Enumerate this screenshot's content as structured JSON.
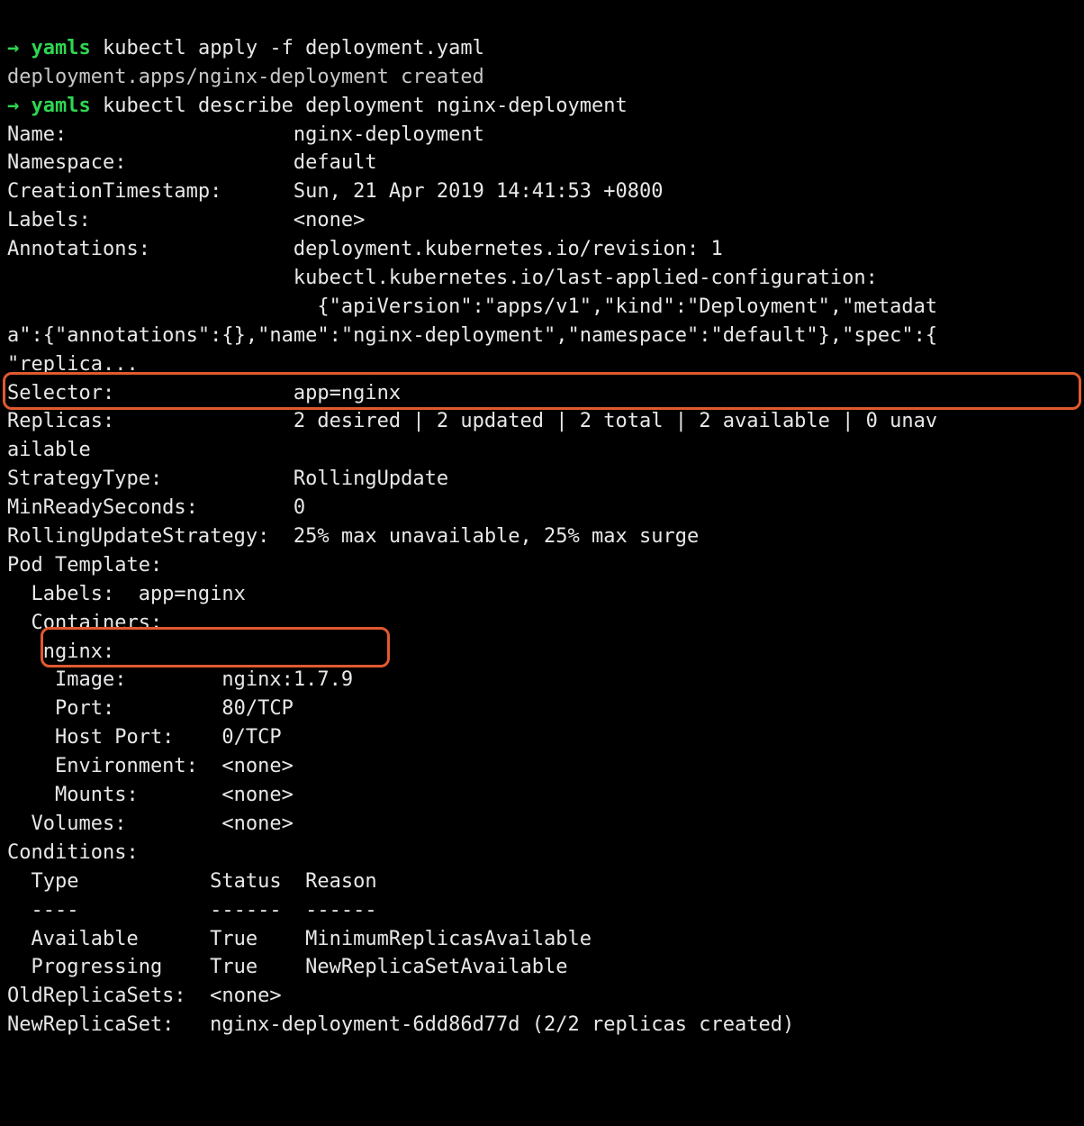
{
  "prompt_arrow": "→",
  "folder": "yamls",
  "cmd1": "kubectl apply -f deployment.yaml",
  "out1": "deployment.apps/nginx-deployment created",
  "cmd2": "kubectl describe deployment nginx-deployment",
  "fields": {
    "name_k": "Name:                   ",
    "name_v": "nginx-deployment",
    "ns_k": "Namespace:              ",
    "ns_v": "default",
    "ct_k": "CreationTimestamp:      ",
    "ct_v": "Sun, 21 Apr 2019 14:41:53 +0800",
    "labels_k": "Labels:                 ",
    "labels_v": "<none>",
    "annot_k": "Annotations:            ",
    "annot_v1": "deployment.kubernetes.io/revision: 1",
    "annot_v2": "                        kubectl.kubernetes.io/last-applied-configuration:",
    "annot_v3": "                          {\"apiVersion\":\"apps/v1\",\"kind\":\"Deployment\",\"metadat",
    "annot_v4": "a\":{\"annotations\":{},\"name\":\"nginx-deployment\",\"namespace\":\"default\"},\"spec\":{",
    "annot_v5": "\"replica...",
    "sel_k": "Selector:               ",
    "sel_v": "app=nginx",
    "rep_k": "Replicas:               ",
    "rep_v": "2 desired | 2 updated | 2 total | 2 available | 0 unav",
    "rep_v2": "ailable",
    "strat_k": "StrategyType:           ",
    "strat_v": "RollingUpdate",
    "mrs_k": "MinReadySeconds:        ",
    "mrs_v": "0",
    "rus_k": "RollingUpdateStrategy:  ",
    "rus_v": "25% max unavailable, 25% max surge",
    "pt_k": "Pod Template:",
    "pt_labels": "  Labels:  app=nginx",
    "pt_containers": "  Containers:",
    "pt_nginx": "   nginx:",
    "pt_image_k": "    Image:        ",
    "pt_image_v": "nginx:1.7.9",
    "pt_port_k": "    Port:         ",
    "pt_port_v": "80/TCP",
    "pt_hport_k": "    Host Port:    ",
    "pt_hport_v": "0/TCP",
    "pt_env_k": "    Environment:  ",
    "pt_env_v": "<none>",
    "pt_mount_k": "    Mounts:       ",
    "pt_mount_v": "<none>",
    "pt_vol_k": "  Volumes:        ",
    "pt_vol_v": "<none>",
    "cond_k": "Conditions:",
    "cond_hdr": "  Type           Status  Reason",
    "cond_sep": "  ----           ------  ------",
    "cond_avail": "  Available      True    MinimumReplicasAvailable",
    "cond_prog": "  Progressing    True    NewReplicaSetAvailable",
    "ors_k": "OldReplicaSets:  ",
    "ors_v": "<none>",
    "nrs_k": "NewReplicaSet:   ",
    "nrs_v": "nginx-deployment-6dd86d77d (2/2 replicas created)"
  }
}
